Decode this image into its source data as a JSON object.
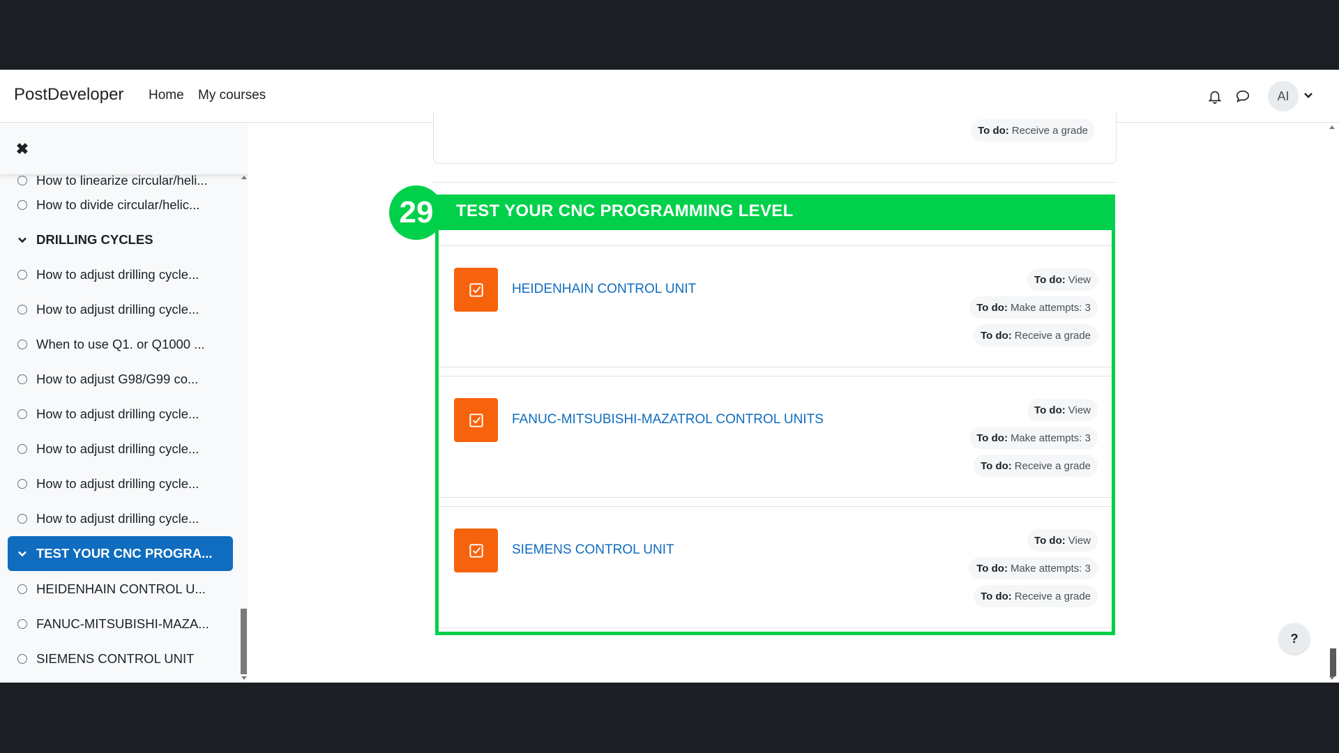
{
  "navbar": {
    "brand": "PostDeveloper",
    "links": [
      "Home",
      "My courses"
    ],
    "avatar_initials": "AI"
  },
  "drawer": {
    "partial_top_item": "How to linearize circular/heli...",
    "items": [
      {
        "type": "activity",
        "label": "How to divide circular/helic..."
      },
      {
        "type": "section",
        "label": "DRILLING CYCLES"
      },
      {
        "type": "activity",
        "label": "How to adjust drilling cycle..."
      },
      {
        "type": "activity",
        "label": "How to adjust drilling cycle..."
      },
      {
        "type": "activity",
        "label": "When to use Q1. or Q1000 ..."
      },
      {
        "type": "activity",
        "label": "How to adjust G98/G99 co..."
      },
      {
        "type": "activity",
        "label": "How to adjust drilling cycle..."
      },
      {
        "type": "activity",
        "label": "How to adjust drilling cycle..."
      },
      {
        "type": "activity",
        "label": "How to adjust drilling cycle..."
      },
      {
        "type": "activity",
        "label": "How to adjust drilling cycle..."
      },
      {
        "type": "section-active",
        "label": "TEST YOUR CNC PROGRA..."
      },
      {
        "type": "activity",
        "label": "HEIDENHAIN CONTROL U..."
      },
      {
        "type": "activity",
        "label": "FANUC-MITSUBISHI-MAZA..."
      },
      {
        "type": "activity",
        "label": "SIEMENS CONTROL UNIT"
      }
    ]
  },
  "prev_card": {
    "todo_label": "To do:",
    "todo_value": "Receive a grade"
  },
  "section": {
    "number": "29",
    "title": "TEST YOUR CNC PROGRAMMING LEVEL",
    "accent_color": "#00d04a",
    "activities": [
      {
        "name": "HEIDENHAIN CONTROL UNIT",
        "todos": [
          {
            "label": "To do:",
            "value": "View"
          },
          {
            "label": "To do:",
            "value": "Make attempts: 3"
          },
          {
            "label": "To do:",
            "value": "Receive a grade"
          }
        ]
      },
      {
        "name": "FANUC-MITSUBISHI-MAZATROL CONTROL UNITS",
        "todos": [
          {
            "label": "To do:",
            "value": "View"
          },
          {
            "label": "To do:",
            "value": "Make attempts: 3"
          },
          {
            "label": "To do:",
            "value": "Receive a grade"
          }
        ]
      },
      {
        "name": "SIEMENS CONTROL UNIT",
        "todos": [
          {
            "label": "To do:",
            "value": "View"
          },
          {
            "label": "To do:",
            "value": "Make attempts: 3"
          },
          {
            "label": "To do:",
            "value": "Receive a grade"
          }
        ]
      }
    ]
  },
  "help_label": "?",
  "colors": {
    "primary": "#0f6cbf",
    "quiz_icon": "#f7630c",
    "section_green": "#00d04a"
  }
}
